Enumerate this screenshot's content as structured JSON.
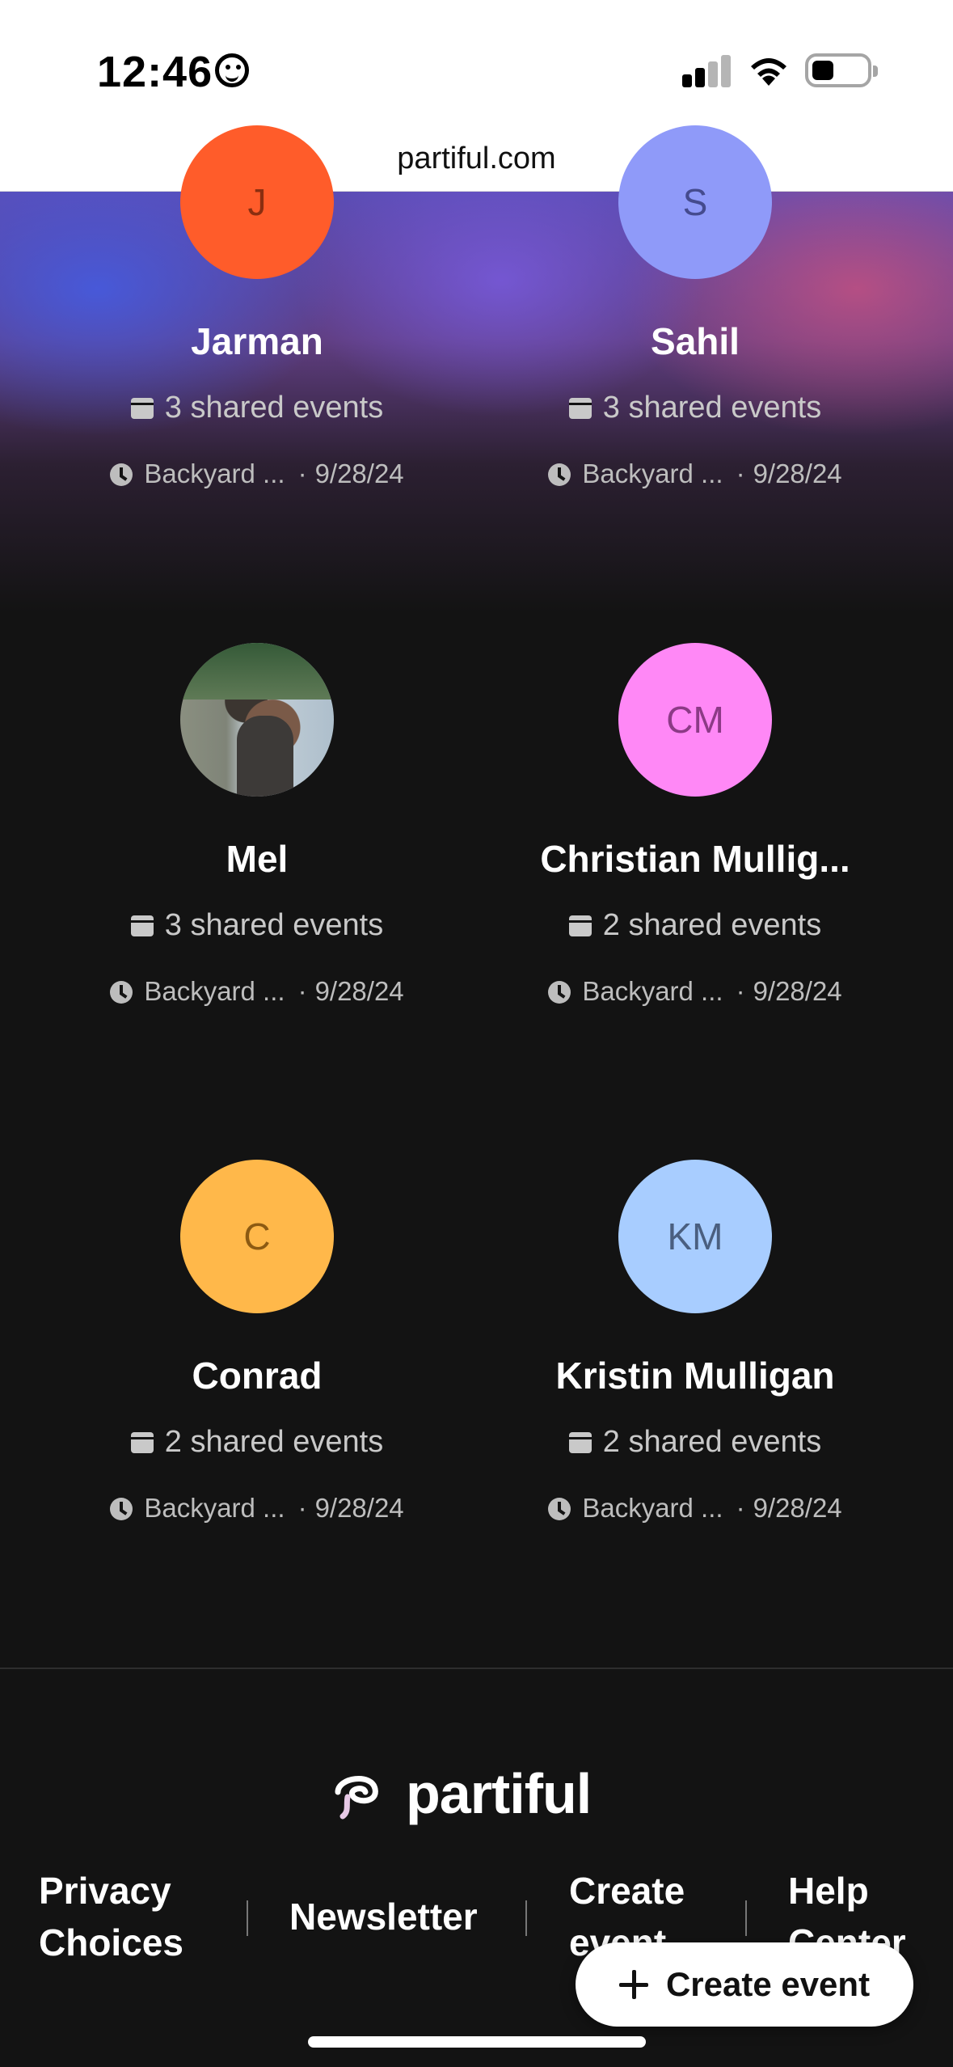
{
  "status_bar": {
    "time": "12:46",
    "icons": [
      "smiley-icon",
      "signal-icon",
      "wifi-icon",
      "battery-icon"
    ]
  },
  "browser": {
    "url": "partiful.com"
  },
  "people": [
    {
      "initials": "J",
      "name": "Jarman",
      "shared_events": "3 shared events",
      "last_event": "Backyard ...",
      "last_date": "9/28/24",
      "avatar_color": "#ff5c2a",
      "initials_color": "#8a2e10"
    },
    {
      "initials": "S",
      "name": "Sahil",
      "shared_events": "3 shared events",
      "last_event": "Backyard ...",
      "last_date": "9/28/24",
      "avatar_color": "#8f9af9",
      "initials_color": "#454b8e"
    },
    {
      "initials": "",
      "name": "Mel",
      "shared_events": "3 shared events",
      "last_event": "Backyard ...",
      "last_date": "9/28/24",
      "avatar_color": "photo",
      "initials_color": "#000000"
    },
    {
      "initials": "CM",
      "name": "Christian Mullig...",
      "shared_events": "2 shared events",
      "last_event": "Backyard ...",
      "last_date": "9/28/24",
      "avatar_color": "#ff88f6",
      "initials_color": "#8c3a86"
    },
    {
      "initials": "C",
      "name": "Conrad",
      "shared_events": "2 shared events",
      "last_event": "Backyard ...",
      "last_date": "9/28/24",
      "avatar_color": "#ffb84a",
      "initials_color": "#8c5a12"
    },
    {
      "initials": "KM",
      "name": "Kristin Mulligan",
      "shared_events": "2 shared events",
      "last_event": "Backyard ...",
      "last_date": "9/28/24",
      "avatar_color": "#a8cdff",
      "initials_color": "#4a5f80"
    }
  ],
  "footer": {
    "logo_text": "partiful",
    "links": [
      "Privacy\nChoices",
      "Newsletter",
      "Create\nevent",
      "Help\nCenter"
    ]
  },
  "create_button": {
    "label": "Create event"
  },
  "colors": {
    "background": "#131313",
    "text_secondary": "#c9c9c9"
  }
}
